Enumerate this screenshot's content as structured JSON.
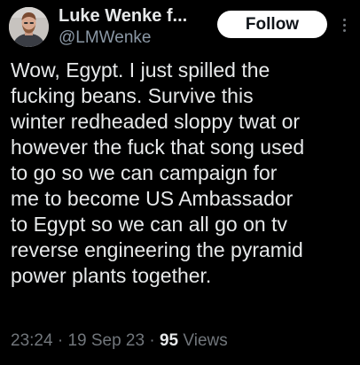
{
  "author": {
    "display_name": "Luke Wenke f...",
    "handle": "@LMWenke",
    "avatar_icon": "user-photo-avatar"
  },
  "actions": {
    "follow_label": "Follow",
    "more_icon": "vertical-ellipsis-icon"
  },
  "tweet": {
    "lines": [
      "Wow, Egypt.  I just spilled the",
      "fucking beans.  Survive this",
      "winter redheaded sloppy twat or",
      "however the fuck that song used",
      "to go so we can campaign for",
      "me to become US Ambassador",
      "to Egypt so we can all go on tv",
      "reverse engineering the pyramid",
      "power plants together."
    ]
  },
  "meta": {
    "time": "23:24",
    "separator": " · ",
    "date": "19 Sep 23",
    "views_count": "95",
    "views_label": " Views"
  },
  "colors": {
    "background": "#000000",
    "text_primary": "#e7e9ea",
    "text_secondary": "#71767b",
    "follow_bg": "#ffffff",
    "follow_text": "#0f1419"
  }
}
